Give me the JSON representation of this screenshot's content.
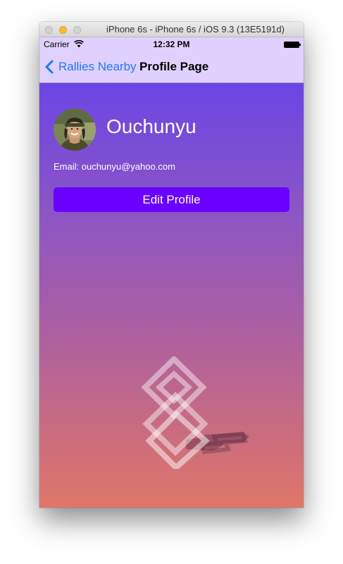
{
  "window": {
    "title": "iPhone 6s - iPhone 6s / iOS 9.3 (13E5191d)"
  },
  "status_bar": {
    "carrier": "Carrier",
    "time": "12:32 PM"
  },
  "nav_bar": {
    "back_label": "Rallies Nearby",
    "title": "Profile Page"
  },
  "profile": {
    "name": "Ouchunyu",
    "email": "Email: ouchunyu@yahoo.com",
    "edit_button_label": "Edit Profile"
  },
  "colors": {
    "nav_background": "#e0d0fd",
    "link_blue": "#1a7bf5",
    "button_purple": "#6a00ff",
    "gradient_top": "#6b46e4",
    "gradient_bottom": "#e07668"
  },
  "icons": [
    "wifi-icon",
    "battery-icon",
    "back-chevron-icon",
    "avatar",
    "app-logo-graphic"
  ]
}
